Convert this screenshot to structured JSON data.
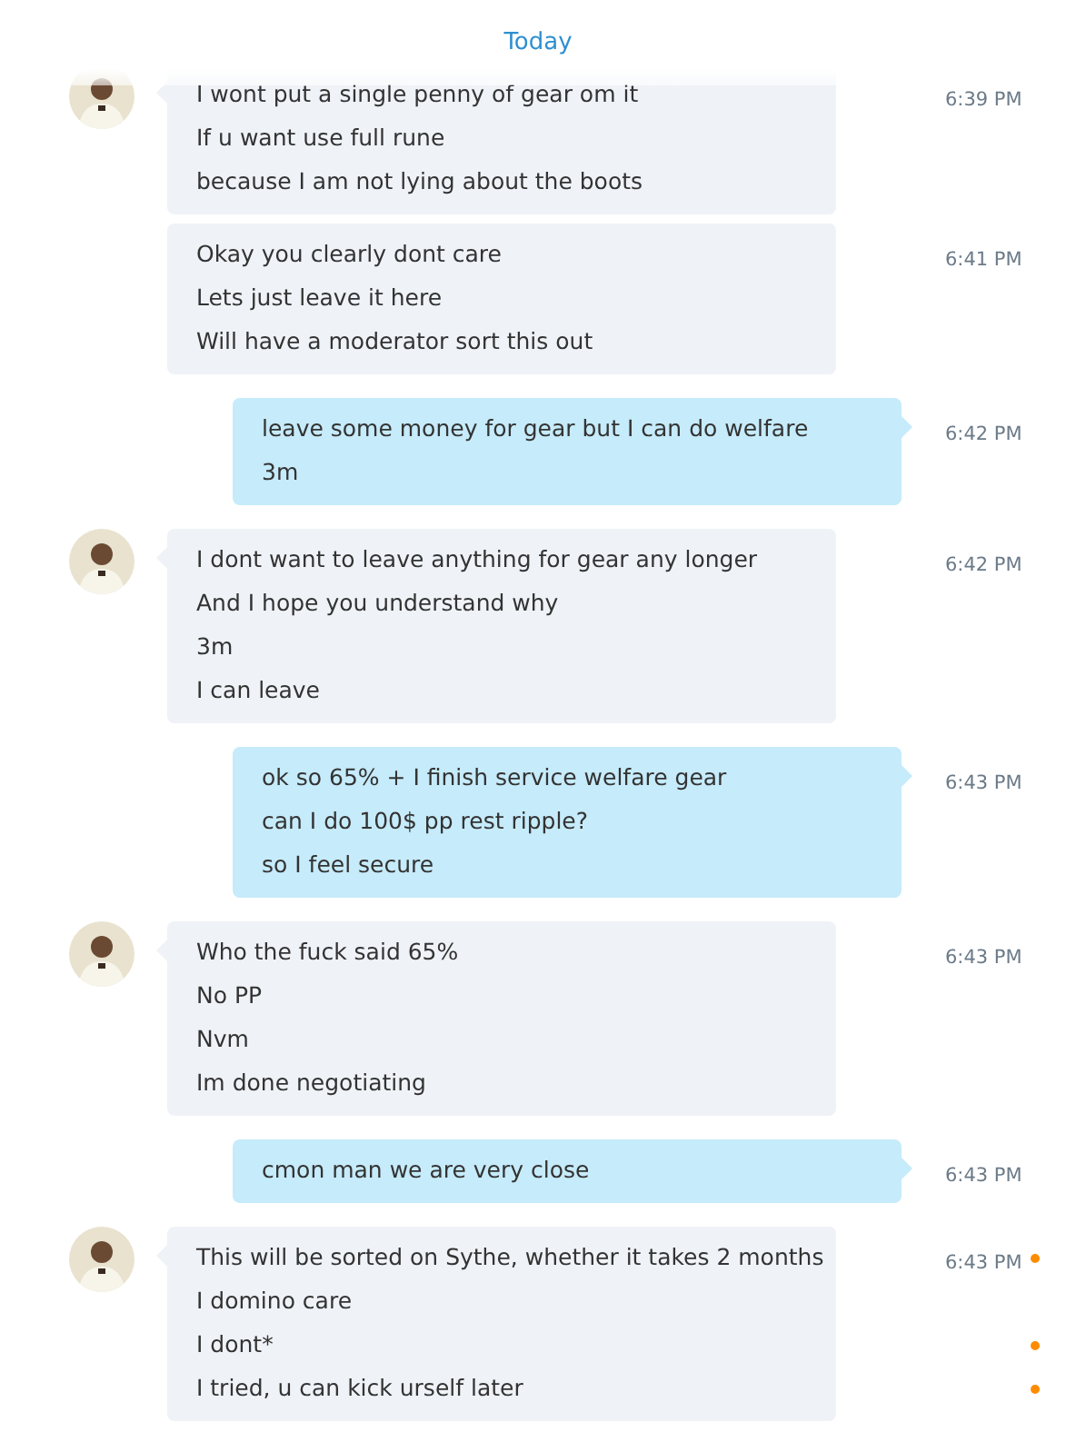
{
  "date_divider": "Today",
  "messages": [
    {
      "kind": "received",
      "avatar": true,
      "time": "6:39 PM",
      "lines": [
        {
          "text": "I wont put a single penny of gear om it"
        },
        {
          "text": "If u want use full rune"
        },
        {
          "text": "because I am not lying about the boots"
        }
      ]
    },
    {
      "kind": "received",
      "avatar": false,
      "time": "6:41 PM",
      "lines": [
        {
          "text": "Okay you clearly dont care"
        },
        {
          "text": "Lets just leave it here"
        },
        {
          "text": "Will have a moderator sort this out"
        }
      ]
    },
    {
      "kind": "sent",
      "avatar": false,
      "time": "6:42 PM",
      "lines": [
        {
          "text": "leave some money for gear but I can do welfare"
        },
        {
          "text": "3m"
        }
      ]
    },
    {
      "kind": "received",
      "avatar": true,
      "time": "6:42 PM",
      "lines": [
        {
          "text": "I dont want to leave anything for gear any longer"
        },
        {
          "text": "And I hope you understand why"
        },
        {
          "text": "3m"
        },
        {
          "text": "I can leave"
        }
      ]
    },
    {
      "kind": "sent",
      "avatar": false,
      "time": "6:43 PM",
      "lines": [
        {
          "text": "ok so 65% + I finish service welfare gear"
        },
        {
          "text": "can I do 100$ pp rest ripple?"
        },
        {
          "text": "so I feel secure"
        }
      ]
    },
    {
      "kind": "received",
      "avatar": true,
      "time": "6:43 PM",
      "lines": [
        {
          "text": "Who the fuck said 65%"
        },
        {
          "text": "No PP"
        },
        {
          "text": "Nvm"
        },
        {
          "text": "Im done negotiating"
        }
      ]
    },
    {
      "kind": "sent",
      "avatar": false,
      "time": "6:43 PM",
      "lines": [
        {
          "text": "cmon man we are very close"
        }
      ]
    },
    {
      "kind": "received",
      "avatar": true,
      "time": "6:43 PM",
      "lines": [
        {
          "text": "This will be sorted on Sythe, whether it takes 2 months",
          "pending": true
        },
        {
          "text": "I domino care",
          "pending": false
        },
        {
          "text": "I dont*",
          "pending": true
        },
        {
          "text": "I tried, u can kick urself later",
          "pending": true
        }
      ]
    }
  ]
}
